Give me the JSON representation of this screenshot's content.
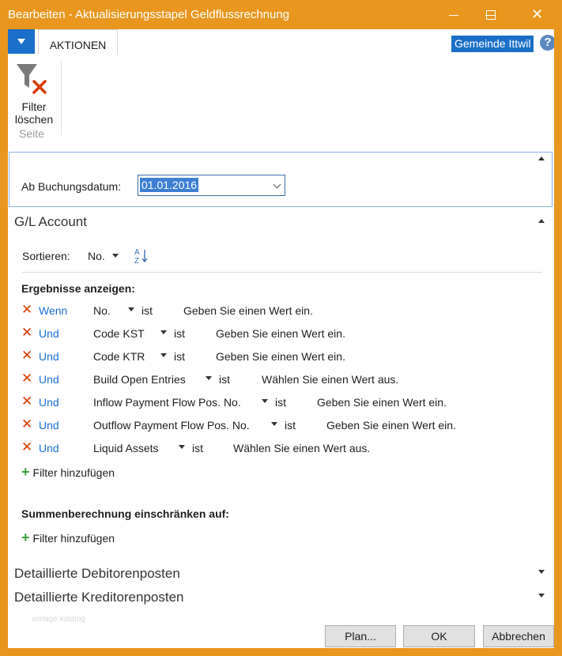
{
  "window": {
    "title": "Bearbeiten - Aktualisierungsstapel Geldflussrechnung"
  },
  "ribbon": {
    "tab_label": "AKTIONEN",
    "company_label": "Gemeinde Ittwil",
    "help_label": "?",
    "filter_button": {
      "line1": "Filter",
      "line2": "löschen"
    },
    "group_label": "Seite"
  },
  "options": {
    "label": "Ab Buchungsdatum:",
    "value": "01.01.2016"
  },
  "gl_account": {
    "title": "G/L Account",
    "sort_label": "Sortieren:",
    "sort_field": "No.",
    "results_heading": "Ergebnisse anzeigen:",
    "filters": [
      {
        "conjunction": "Wenn",
        "field": "No.",
        "operator": "ist",
        "placeholder": "Geben Sie einen Wert ein."
      },
      {
        "conjunction": "Und",
        "field": "Code KST",
        "operator": "ist",
        "placeholder": "Geben Sie einen Wert ein."
      },
      {
        "conjunction": "Und",
        "field": "Code KTR",
        "operator": "ist",
        "placeholder": "Geben Sie einen Wert ein."
      },
      {
        "conjunction": "Und",
        "field": "Build Open Entries",
        "operator": "ist",
        "placeholder": "Wählen Sie einen Wert aus."
      },
      {
        "conjunction": "Und",
        "field": "Inflow Payment Flow Pos. No.",
        "operator": "ist",
        "placeholder": "Geben Sie einen Wert ein."
      },
      {
        "conjunction": "Und",
        "field": "Outflow Payment Flow Pos. No.",
        "operator": "ist",
        "placeholder": "Geben Sie einen Wert ein."
      },
      {
        "conjunction": "Und",
        "field": "Liquid Assets",
        "operator": "ist",
        "placeholder": "Wählen Sie einen Wert aus."
      }
    ],
    "add_filter_label": "Filter hinzufügen",
    "totals_heading": "Summenberechnung einschränken auf:",
    "add_totals_filter_label": "Filter hinzufügen"
  },
  "collapsed_sections": [
    "Detaillierte Debitorenposten",
    "Detaillierte Kreditorenposten"
  ],
  "watermark": "vorlage katalog",
  "footer": {
    "plan": "Plan...",
    "ok": "OK",
    "cancel": "Abbrechen"
  },
  "colors": {
    "accent": "#e8961e",
    "blue": "#1b6fc8",
    "link": "#1a6fd6",
    "remove": "#d83b01",
    "add": "#3ca03c"
  }
}
